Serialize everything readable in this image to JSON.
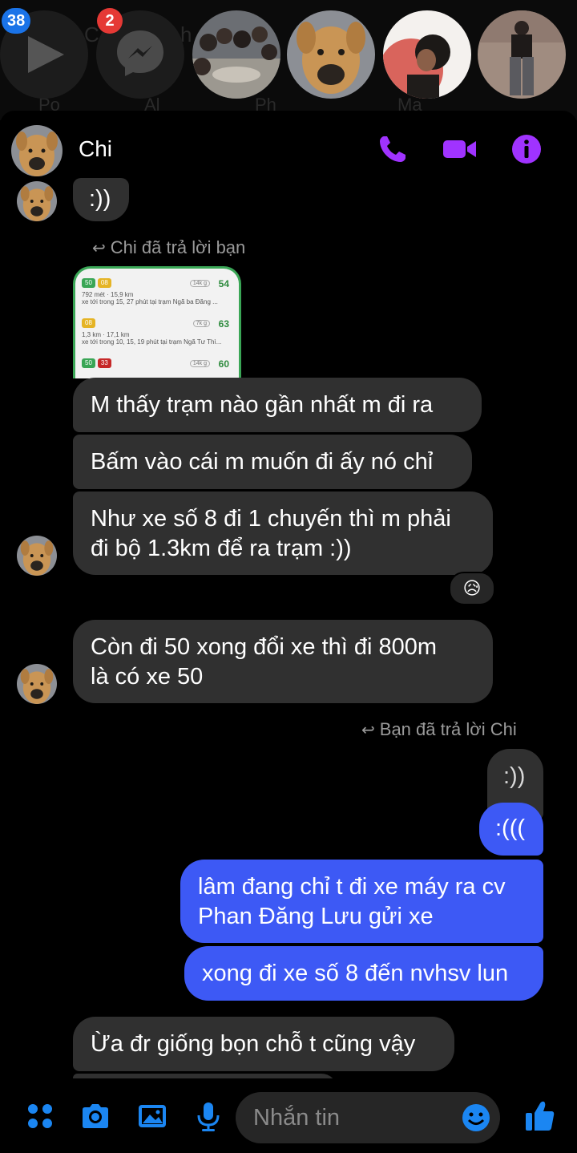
{
  "top_bar": {
    "video_badge": "38",
    "messenger_badge": "2",
    "ghost_text_1": "C",
    "ghost_text_2": "h",
    "ghost_tabs": [
      "Po",
      "Al",
      "Ph",
      "Ma"
    ]
  },
  "header": {
    "contact_name": "Chi",
    "icons": [
      "phone-icon",
      "video-call-icon",
      "info-icon"
    ],
    "accent": "#a033ff"
  },
  "messages": {
    "m0": ":))",
    "reply_note_1": "Chi đã trả lời bạn",
    "attachment": {
      "routes": [
        {
          "tags": [
            "50",
            "08"
          ],
          "walk": "792 mét",
          "dist": "15,9 km",
          "desc": "xe tới trong 15, 27 phút tại trạm Ngã ba Đăng ...",
          "load": "14k g",
          "mins": "54"
        },
        {
          "tags": [
            "08"
          ],
          "walk": "1,3 km",
          "dist": "17,1 km",
          "desc": "xe tới trong 10, 15, 19 phút tại trạm Ngã Tư Thì...",
          "load": "7k g",
          "mins": "63"
        },
        {
          "tags": [
            "50",
            "33"
          ],
          "walk": "",
          "dist": "",
          "desc": "",
          "load": "14k g",
          "mins": "60"
        }
      ]
    },
    "m1": "M thấy trạm nào gần nhất m đi ra",
    "m2": "Bấm vào cái m muốn đi ấy nó chỉ",
    "m3_line1": "Như xe số 8 đi 1 chuyến thì m phải",
    "m3_line2": "đi bộ 1.3km để ra trạm :))",
    "reaction": "😥",
    "m4_line1": "Còn đi 50 xong đổi xe thì đi 800m",
    "m4_line2": "là có xe 50",
    "reply_note_2": "Bạn đã trả lời Chi",
    "quoted": ":))",
    "m5": ":(((",
    "m6_line1": "lâm đang chỉ t đi xe máy ra cv",
    "m6_line2": "Phan Đăng Lưu gửi xe",
    "m7": "xong đi xe số 8 đến nvhsv lun",
    "m8": "Ừa đr giống bọn chỗ t cũng vậy"
  },
  "composer": {
    "placeholder": "Nhắn tin",
    "icons": [
      "menu-grid-icon",
      "camera-icon",
      "gallery-icon",
      "microphone-icon",
      "emoji-icon",
      "like-icon"
    ],
    "accent": "#1b86f2"
  },
  "colors": {
    "incoming_bubble": "#303030",
    "outgoing_bubble": "#3d59f5",
    "badge_blue": "#1a73e8",
    "badge_red": "#e53935"
  }
}
